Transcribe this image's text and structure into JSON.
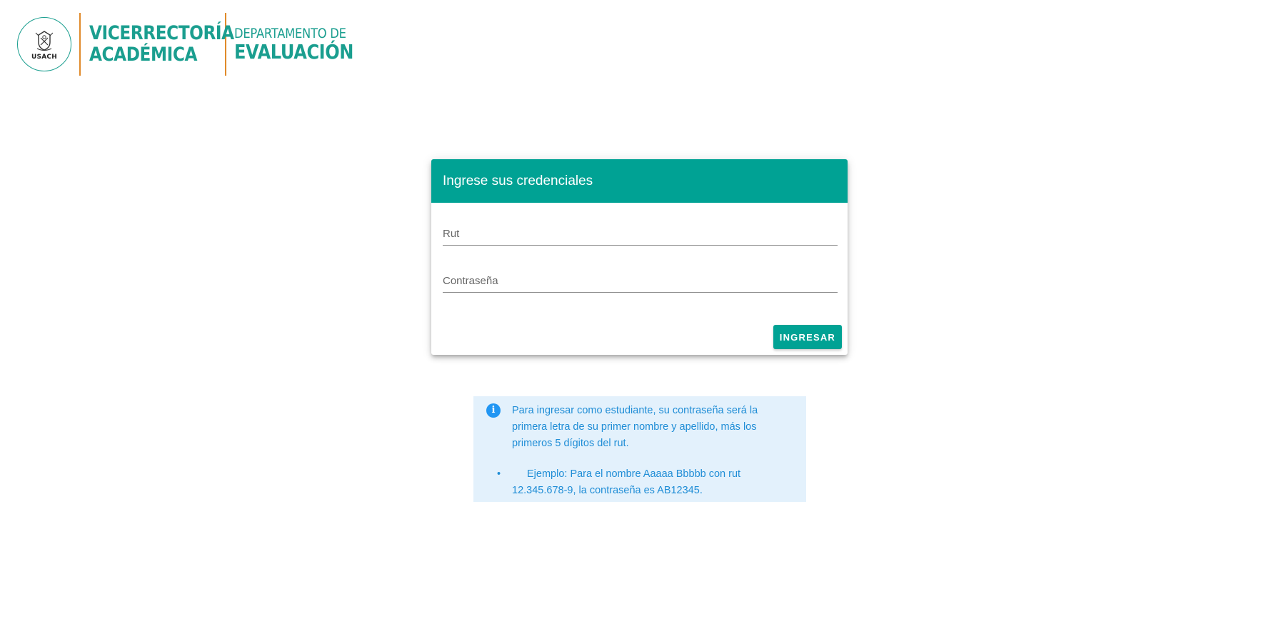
{
  "header": {
    "seal_text": "USACH",
    "brand_line1": "VICERRECTORÍA",
    "brand_line2": "ACADÉMICA",
    "dept_line1": "DEPARTAMENTO DE",
    "dept_line2": "EVALUACIÓN"
  },
  "login": {
    "title": "Ingrese sus credenciales",
    "rut_placeholder": "Rut",
    "rut_value": "",
    "password_placeholder": "Contraseña",
    "password_value": "",
    "submit_label": "INGRESAR"
  },
  "info": {
    "icon": "info-icon",
    "message": "Para ingresar como estudiante, su contraseña será la primera letra de su primer nombre y apellido, más los primeros 5 dígitos del rut.",
    "example": "Ejemplo: Para el nombre Aaaaa Bbbbb con rut 12.345.678-9, la contraseña es AB12345."
  },
  "colors": {
    "primary": "#00a294",
    "brand_text": "#1a9e8f",
    "divider": "#e08a2a",
    "info_bg": "#e3f1fc",
    "info_text": "#1f8dd6"
  }
}
